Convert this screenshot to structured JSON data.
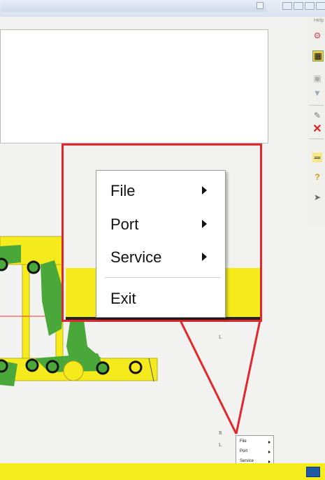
{
  "toolbar": {
    "help_label": "Help"
  },
  "context_menu": {
    "items": [
      {
        "label": "File",
        "has_submenu": true
      },
      {
        "label": "Port",
        "has_submenu": true
      },
      {
        "label": "Service",
        "has_submenu": true
      },
      {
        "label": "Exit",
        "has_submenu": false
      }
    ]
  },
  "canvas_labels": {
    "r_label": "R",
    "l_label_top": "L",
    "l_label_bottom": "L"
  },
  "colors": {
    "highlight_border": "#e3262c",
    "yellow": "#f4ea1c",
    "green": "#4aa83a"
  },
  "icons": [
    "restore-icon",
    "maximize-icon",
    "close-icon",
    "tool-icon",
    "wrench-icon",
    "delete-icon",
    "help-icon",
    "pointer-icon"
  ]
}
